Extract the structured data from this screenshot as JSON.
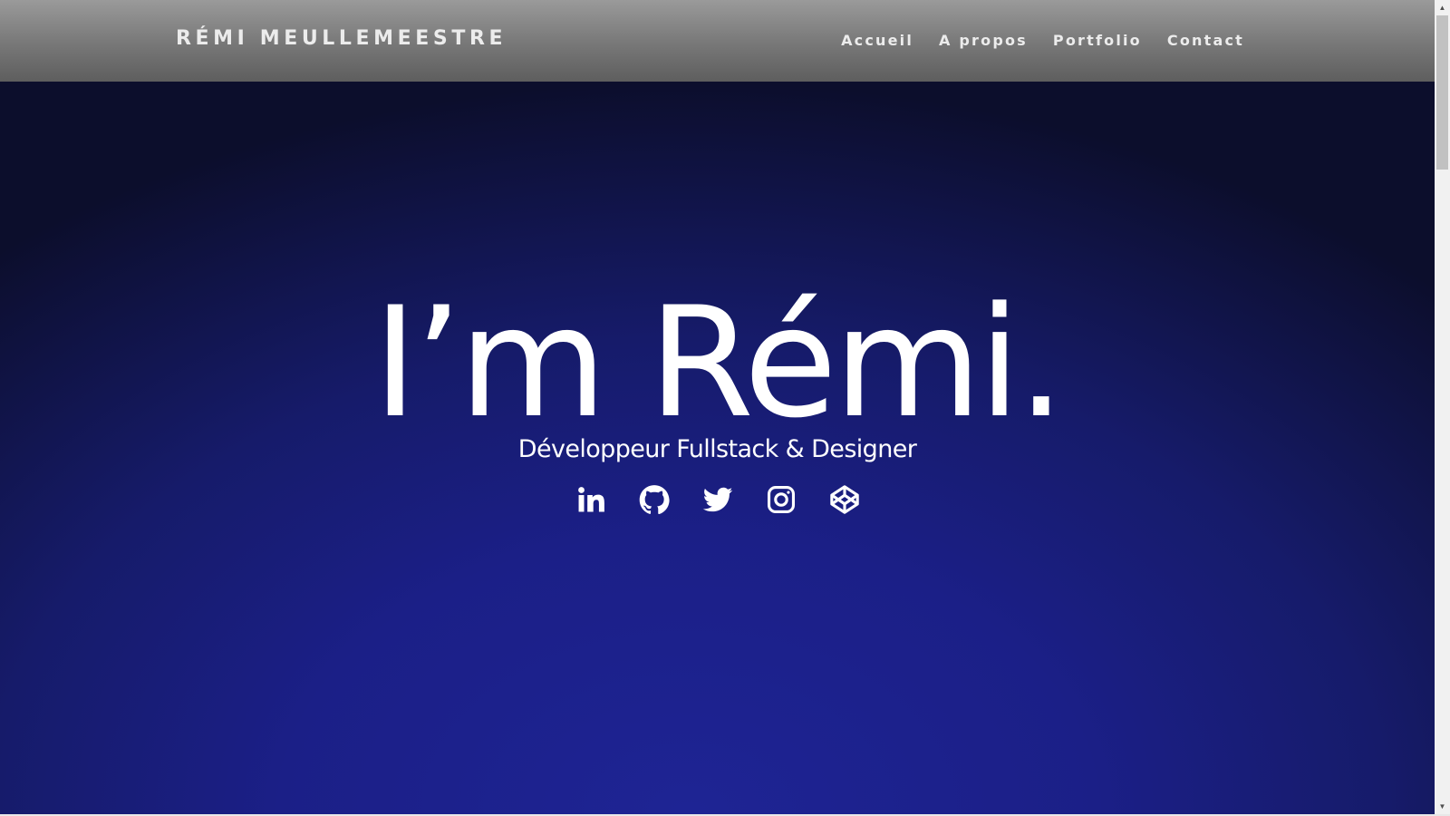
{
  "header": {
    "logo": "RÉMI MEULLEMEESTRE",
    "nav": [
      {
        "label": "Accueil"
      },
      {
        "label": "A propos"
      },
      {
        "label": "Portfolio"
      },
      {
        "label": "Contact"
      }
    ]
  },
  "hero": {
    "title": "I’m Rémi.",
    "subtitle": "Développeur Fullstack & Designer",
    "socials": [
      {
        "icon": "linkedin-icon"
      },
      {
        "icon": "github-icon"
      },
      {
        "icon": "twitter-icon"
      },
      {
        "icon": "instagram-icon"
      },
      {
        "icon": "codepen-icon"
      }
    ]
  },
  "colors": {
    "hero_center": "#1e2494",
    "hero_edge": "#0c0e2c",
    "header_top": "#9a9a9a",
    "header_bottom": "#5e5e5e",
    "text": "#ffffff"
  }
}
